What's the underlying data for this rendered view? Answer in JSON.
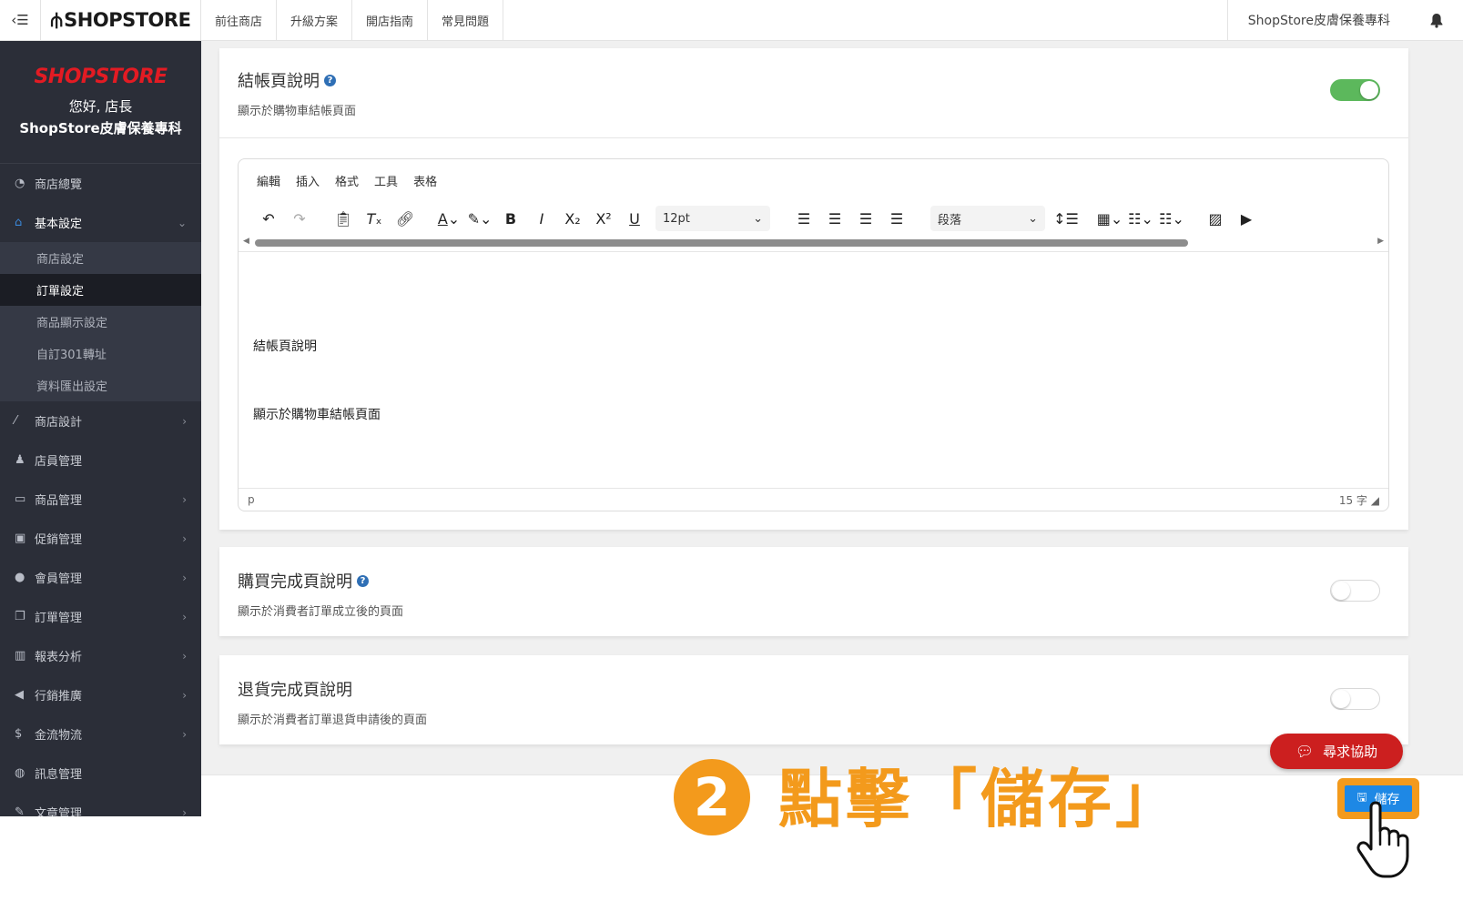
{
  "topbar": {
    "toggle_icon": "menu-icon",
    "logo": "SHOPSTORE",
    "nav": [
      "前往商店",
      "升級方案",
      "開店指南",
      "常見問題"
    ],
    "store_name": "ShopStore皮膚保養專科",
    "bell_icon": "bell-icon"
  },
  "sidebar": {
    "logo": "SHOPSTORE",
    "greeting": "您好, 店長",
    "store_name": "ShopStore皮膚保養專科",
    "items": [
      {
        "label": "商店總覽",
        "icon": "dashboard-icon"
      },
      {
        "label": "基本設定",
        "icon": "bank-icon"
      },
      {
        "label": "商店設計",
        "icon": "magic-wand-icon"
      },
      {
        "label": "店員管理",
        "icon": "user-staff-icon"
      },
      {
        "label": "商品管理",
        "icon": "cart-icon"
      },
      {
        "label": "促銷管理",
        "icon": "gift-icon"
      },
      {
        "label": "會員管理",
        "icon": "users-icon"
      },
      {
        "label": "訂單管理",
        "icon": "copy-icon"
      },
      {
        "label": "報表分析",
        "icon": "bar-chart-icon"
      },
      {
        "label": "行銷推廣",
        "icon": "bullhorn-icon"
      },
      {
        "label": "金流物流",
        "icon": "dollar-icon"
      },
      {
        "label": "訊息管理",
        "icon": "chat-icon"
      },
      {
        "label": "文章管理",
        "icon": "edit-icon"
      }
    ],
    "subitems": [
      "商店設定",
      "訂單設定",
      "商品顯示設定",
      "自訂301轉址",
      "資料匯出設定"
    ]
  },
  "checkout_card": {
    "title": "結帳頁說明",
    "subtitle": "顯示於購物車結帳頁面",
    "toggle_on": true
  },
  "editor": {
    "menu": [
      "編輯",
      "插入",
      "格式",
      "工具",
      "表格"
    ],
    "font_size": "12pt",
    "block_format": "段落",
    "content_line1": "結帳頁說明",
    "content_line2": "顯示於購物車結帳頁面",
    "status_path": "p",
    "word_count": "15 字"
  },
  "purchase_card": {
    "title": "購買完成頁說明",
    "subtitle": "顯示於消費者訂單成立後的頁面",
    "toggle_on": false
  },
  "return_card": {
    "title": "退貨完成頁說明",
    "subtitle": "顯示於消費者訂單退貨申請後的頁面",
    "toggle_on": false
  },
  "help_button": "尋求協助",
  "save_button": "儲存",
  "annotation": {
    "step": "2",
    "text": "點擊「儲存」"
  },
  "colors": {
    "accent_orange": "#f39a1c",
    "toggle_on": "#5cb85c",
    "save_blue": "#1e88e5",
    "help_red": "#cc1f1f",
    "sidebar_bg": "#2b2e38"
  }
}
